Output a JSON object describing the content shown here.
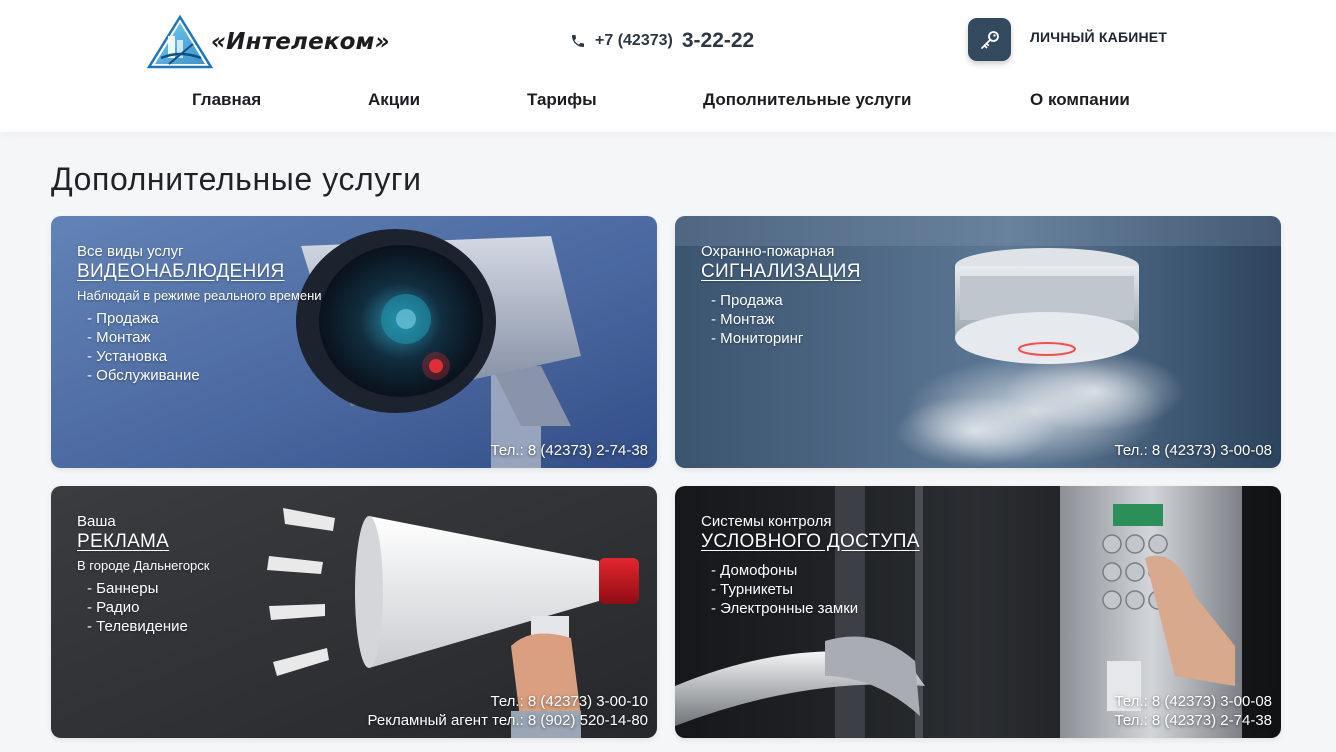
{
  "brand": {
    "name": "«Интелеком»"
  },
  "header": {
    "phone_prefix": "+7 (42373)",
    "phone_main": "3-22-22",
    "cabinet_label": "ЛИЧНЫЙ КАБИНЕТ"
  },
  "nav": {
    "items": [
      "Главная",
      "Акции",
      "Тарифы",
      "Дополнительные услуги",
      "О компании"
    ]
  },
  "page": {
    "title": "Дополнительные услуги"
  },
  "cards": [
    {
      "kicker": "Все виды услуг",
      "title": "ВИДЕОНАБЛЮДЕНИЯ",
      "subtitle": "Наблюдай в режиме реального времени",
      "items": [
        "- Продажа",
        "- Монтаж",
        "- Установка",
        "- Обслуживание"
      ],
      "phones": [
        "Тел.: 8 (42373) 2-74-38"
      ]
    },
    {
      "kicker": "Охранно-пожарная",
      "title": "СИГНАЛИЗАЦИЯ",
      "items": [
        "- Продажа",
        "- Монтаж",
        "- Мониторинг"
      ],
      "phones": [
        "Тел.: 8 (42373) 3-00-08"
      ]
    },
    {
      "kicker": "Ваша",
      "title": "РЕКЛАМА",
      "subtitle": "В городе Дальнегорск",
      "items": [
        "- Баннеры",
        "- Радио",
        "- Телевидение"
      ],
      "phones": [
        "Тел.: 8 (42373) 3-00-10",
        "Рекламный агент тел.: 8 (902) 520-14-80"
      ]
    },
    {
      "kicker": "Системы контроля",
      "title": "УСЛОВНОГО ДОСТУПА",
      "items": [
        "- Домофоны",
        "- Турникеты",
        "- Электронные замки"
      ],
      "phones": [
        "Тел.: 8 (42373) 3-00-08",
        "Тел.: 8 (42373) 2-74-38"
      ]
    }
  ],
  "colors": {
    "header_bg": "#ffffff",
    "page_bg": "#f5f6f8",
    "cabinet_button": "#33495e",
    "logo_blue": "#2a9fd8",
    "text_dark": "#1b1d21"
  },
  "icons": {
    "logo": "intelecom-triangle-logo",
    "phone": "phone-icon",
    "cabinet": "key-icon"
  }
}
